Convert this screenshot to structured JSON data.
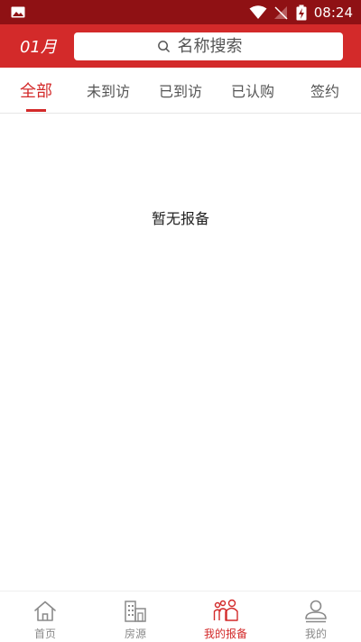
{
  "status_bar": {
    "time": "08:24"
  },
  "header": {
    "month": "01月",
    "search_placeholder": "名称搜索"
  },
  "tabs": [
    {
      "label": "全部",
      "active": true
    },
    {
      "label": "未到访",
      "active": false
    },
    {
      "label": "已到访",
      "active": false
    },
    {
      "label": "已认购",
      "active": false
    },
    {
      "label": "签约",
      "active": false
    }
  ],
  "empty_message": "暂无报备",
  "bottom_nav": [
    {
      "label": "首页",
      "icon": "home-icon",
      "active": false
    },
    {
      "label": "房源",
      "icon": "building-icon",
      "active": false
    },
    {
      "label": "我的报备",
      "icon": "people-icon",
      "active": true
    },
    {
      "label": "我的",
      "icon": "user-icon",
      "active": false
    }
  ],
  "colors": {
    "status_bar": "#8f1114",
    "header": "#d32a2a",
    "accent": "#d32a2a",
    "inactive": "#8a8a8a"
  }
}
